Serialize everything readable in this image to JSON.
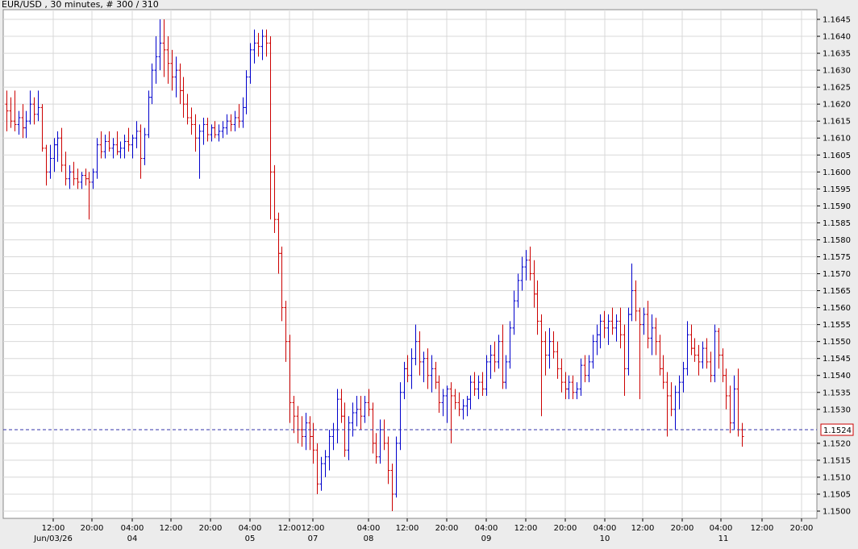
{
  "header": {
    "title": "EUR/USD , 30 minutes, # 300 / 310"
  },
  "colors": {
    "up_bar": "#0000cc",
    "down_bar": "#cc0000",
    "price_line": "#3333aa",
    "price_tag_border": "#cc0000",
    "grid": "#d8d8d8",
    "plot_bg": "#ffffff"
  },
  "chart_data": {
    "type": "ohlc",
    "title": "EUR/USD , 30 minutes, # 300 / 310",
    "grid": true,
    "ylim": [
      1.15,
      1.1645
    ],
    "x_tick_labels": [
      "12:00",
      "20:00",
      "04:00",
      "12:00",
      "20:00",
      "04:00",
      "12:00",
      "12:00",
      "04:00",
      "12:00",
      "20:00",
      "04:00",
      "12:00",
      "20:00",
      "04:00",
      "12:00",
      "20:00",
      "04:00",
      "12:00",
      "20:00"
    ],
    "date_labels": [
      "Jun/03/26",
      "04",
      "05",
      "07",
      "08",
      "09",
      "10",
      "11"
    ],
    "y_tick_labels": [
      "1.1645",
      "1.1640",
      "1.1635",
      "1.1630",
      "1.1625",
      "1.1620",
      "1.1615",
      "1.1610",
      "1.1605",
      "1.1600",
      "1.1595",
      "1.1590",
      "1.1585",
      "1.1580",
      "1.1575",
      "1.1570",
      "1.1565",
      "1.1560",
      "1.1555",
      "1.1550",
      "1.1545",
      "1.1540",
      "1.1535",
      "1.1530",
      "1.1524",
      "1.1520",
      "1.1515",
      "1.1510",
      "1.1505",
      "1.1500"
    ],
    "current_price": "1.1524",
    "bars": [
      [
        1.162,
        1.1624,
        1.1612,
        1.1618
      ],
      [
        1.1618,
        1.1622,
        1.1613,
        1.1615
      ],
      [
        1.1615,
        1.1624,
        1.1612,
        1.1614
      ],
      [
        1.1614,
        1.1618,
        1.1611,
        1.1616
      ],
      [
        1.1616,
        1.162,
        1.161,
        1.1613
      ],
      [
        1.1613,
        1.1618,
        1.161,
        1.1615
      ],
      [
        1.1615,
        1.1624,
        1.1614,
        1.162
      ],
      [
        1.162,
        1.1622,
        1.1614,
        1.1617
      ],
      [
        1.1617,
        1.1624,
        1.1615,
        1.1619
      ],
      [
        1.1619,
        1.162,
        1.1606,
        1.1607
      ],
      [
        1.1607,
        1.1608,
        1.1596,
        1.16
      ],
      [
        1.16,
        1.1608,
        1.1598,
        1.1604
      ],
      [
        1.1604,
        1.161,
        1.16,
        1.1608
      ],
      [
        1.1608,
        1.1612,
        1.1603,
        1.161
      ],
      [
        1.161,
        1.1613,
        1.16,
        1.1602
      ],
      [
        1.1602,
        1.1606,
        1.1596,
        1.1598
      ],
      [
        1.1598,
        1.1602,
        1.1595,
        1.16
      ],
      [
        1.16,
        1.1603,
        1.1596,
        1.1598
      ],
      [
        1.1598,
        1.1601,
        1.1595,
        1.1597
      ],
      [
        1.1597,
        1.16,
        1.1595,
        1.1599
      ],
      [
        1.1599,
        1.1601,
        1.1596,
        1.1598
      ],
      [
        1.1598,
        1.16,
        1.1586,
        1.1597
      ],
      [
        1.1597,
        1.1601,
        1.1595,
        1.16
      ],
      [
        1.16,
        1.161,
        1.1598,
        1.1608
      ],
      [
        1.1608,
        1.1612,
        1.1604,
        1.1606
      ],
      [
        1.1606,
        1.1611,
        1.1604,
        1.1609
      ],
      [
        1.1609,
        1.1612,
        1.1606,
        1.1607
      ],
      [
        1.1607,
        1.161,
        1.1604,
        1.1608
      ],
      [
        1.1608,
        1.1612,
        1.1605,
        1.1606
      ],
      [
        1.1606,
        1.1609,
        1.1604,
        1.1607
      ],
      [
        1.1607,
        1.1611,
        1.1604,
        1.1609
      ],
      [
        1.1609,
        1.1613,
        1.1606,
        1.1608
      ],
      [
        1.1608,
        1.1611,
        1.1604,
        1.161
      ],
      [
        1.161,
        1.1615,
        1.1607,
        1.1612
      ],
      [
        1.1612,
        1.1614,
        1.1598,
        1.1604
      ],
      [
        1.1604,
        1.1613,
        1.1602,
        1.1611
      ],
      [
        1.1611,
        1.1624,
        1.161,
        1.1622
      ],
      [
        1.1622,
        1.1632,
        1.162,
        1.163
      ],
      [
        1.163,
        1.164,
        1.1626,
        1.1634
      ],
      [
        1.1634,
        1.1645,
        1.163,
        1.1638
      ],
      [
        1.1638,
        1.1645,
        1.1628,
        1.1636
      ],
      [
        1.1636,
        1.164,
        1.1626,
        1.1632
      ],
      [
        1.1632,
        1.1636,
        1.1624,
        1.1628
      ],
      [
        1.1628,
        1.1634,
        1.1622,
        1.163
      ],
      [
        1.163,
        1.1632,
        1.162,
        1.1624
      ],
      [
        1.1624,
        1.1628,
        1.1616,
        1.162
      ],
      [
        1.162,
        1.1623,
        1.1614,
        1.1616
      ],
      [
        1.1616,
        1.1619,
        1.1611,
        1.1614
      ],
      [
        1.1614,
        1.1617,
        1.1606,
        1.161
      ],
      [
        1.161,
        1.1614,
        1.1598,
        1.1612
      ],
      [
        1.1612,
        1.1616,
        1.1608,
        1.1614
      ],
      [
        1.1614,
        1.1616,
        1.1609,
        1.1611
      ],
      [
        1.1611,
        1.1614,
        1.1609,
        1.1613
      ],
      [
        1.1613,
        1.1615,
        1.161,
        1.1611
      ],
      [
        1.1611,
        1.1614,
        1.1609,
        1.1612
      ],
      [
        1.1612,
        1.1615,
        1.161,
        1.1613
      ],
      [
        1.1613,
        1.1617,
        1.1611,
        1.1615
      ],
      [
        1.1615,
        1.1617,
        1.1612,
        1.1614
      ],
      [
        1.1614,
        1.1618,
        1.1612,
        1.1616
      ],
      [
        1.1616,
        1.162,
        1.1613,
        1.1615
      ],
      [
        1.1615,
        1.1622,
        1.1613,
        1.1619
      ],
      [
        1.1619,
        1.163,
        1.1617,
        1.1628
      ],
      [
        1.1628,
        1.1638,
        1.1626,
        1.1636
      ],
      [
        1.1636,
        1.1642,
        1.1632,
        1.1638
      ],
      [
        1.1638,
        1.1641,
        1.1634,
        1.1637
      ],
      [
        1.1637,
        1.1642,
        1.1633,
        1.164
      ],
      [
        1.164,
        1.1642,
        1.1634,
        1.1638
      ],
      [
        1.1638,
        1.164,
        1.1586,
        1.16
      ],
      [
        1.16,
        1.1602,
        1.1582,
        1.1586
      ],
      [
        1.1586,
        1.1588,
        1.157,
        1.1576
      ],
      [
        1.1576,
        1.1578,
        1.1556,
        1.156
      ],
      [
        1.156,
        1.1562,
        1.1544,
        1.155
      ],
      [
        1.155,
        1.1552,
        1.1526,
        1.1532
      ],
      [
        1.1532,
        1.1534,
        1.1523,
        1.1528
      ],
      [
        1.1528,
        1.1531,
        1.152,
        1.1524
      ],
      [
        1.1524,
        1.1528,
        1.1519,
        1.1522
      ],
      [
        1.1522,
        1.1529,
        1.1518,
        1.1526
      ],
      [
        1.1526,
        1.1528,
        1.1518,
        1.1522
      ],
      [
        1.1522,
        1.1526,
        1.1514,
        1.1518
      ],
      [
        1.1518,
        1.152,
        1.1505,
        1.1508
      ],
      [
        1.1508,
        1.1516,
        1.1506,
        1.1514
      ],
      [
        1.1514,
        1.1518,
        1.151,
        1.1516
      ],
      [
        1.1516,
        1.1524,
        1.1512,
        1.1522
      ],
      [
        1.1522,
        1.1526,
        1.1518,
        1.1524
      ],
      [
        1.1524,
        1.1536,
        1.152,
        1.1533
      ],
      [
        1.1533,
        1.1536,
        1.1526,
        1.1528
      ],
      [
        1.1528,
        1.1532,
        1.1516,
        1.1518
      ],
      [
        1.1518,
        1.1528,
        1.1515,
        1.1526
      ],
      [
        1.1526,
        1.1532,
        1.1522,
        1.1529
      ],
      [
        1.1529,
        1.1534,
        1.1525,
        1.153
      ],
      [
        1.153,
        1.1534,
        1.1524,
        1.1528
      ],
      [
        1.1528,
        1.1534,
        1.1526,
        1.1532
      ],
      [
        1.1532,
        1.1536,
        1.1528,
        1.153
      ],
      [
        1.153,
        1.1532,
        1.1517,
        1.152
      ],
      [
        1.152,
        1.1523,
        1.1514,
        1.1516
      ],
      [
        1.1516,
        1.1527,
        1.1514,
        1.1524
      ],
      [
        1.1524,
        1.1527,
        1.1518,
        1.152
      ],
      [
        1.152,
        1.1522,
        1.1508,
        1.1512
      ],
      [
        1.1512,
        1.1514,
        1.15,
        1.1505
      ],
      [
        1.1505,
        1.1522,
        1.1504,
        1.152
      ],
      [
        1.152,
        1.1538,
        1.1518,
        1.1535
      ],
      [
        1.1535,
        1.1544,
        1.1533,
        1.1542
      ],
      [
        1.1542,
        1.1546,
        1.1538,
        1.154
      ],
      [
        1.154,
        1.1548,
        1.1536,
        1.1545
      ],
      [
        1.1545,
        1.1555,
        1.1543,
        1.155
      ],
      [
        1.155,
        1.1553,
        1.154,
        1.1544
      ],
      [
        1.1544,
        1.1547,
        1.1538,
        1.1545
      ],
      [
        1.1545,
        1.1548,
        1.1536,
        1.154
      ],
      [
        1.154,
        1.1546,
        1.1535,
        1.1542
      ],
      [
        1.1542,
        1.1544,
        1.1536,
        1.1538
      ],
      [
        1.1538,
        1.154,
        1.1529,
        1.1532
      ],
      [
        1.1532,
        1.1536,
        1.1528,
        1.1534
      ],
      [
        1.1534,
        1.1537,
        1.1526,
        1.1536
      ],
      [
        1.1536,
        1.1538,
        1.152,
        1.1534
      ],
      [
        1.1534,
        1.1536,
        1.153,
        1.1532
      ],
      [
        1.1532,
        1.1535,
        1.1528,
        1.153
      ],
      [
        1.153,
        1.1533,
        1.1527,
        1.1531
      ],
      [
        1.1531,
        1.1534,
        1.1528,
        1.1533
      ],
      [
        1.1533,
        1.154,
        1.153,
        1.1538
      ],
      [
        1.1538,
        1.1541,
        1.1534,
        1.1536
      ],
      [
        1.1536,
        1.154,
        1.1533,
        1.1538
      ],
      [
        1.1538,
        1.1541,
        1.1534,
        1.1536
      ],
      [
        1.1536,
        1.1546,
        1.1534,
        1.1544
      ],
      [
        1.1544,
        1.1549,
        1.1539,
        1.1546
      ],
      [
        1.1546,
        1.155,
        1.1541,
        1.1544
      ],
      [
        1.1544,
        1.1552,
        1.1542,
        1.155
      ],
      [
        1.155,
        1.1555,
        1.1536,
        1.1538
      ],
      [
        1.1538,
        1.1546,
        1.1536,
        1.1544
      ],
      [
        1.1544,
        1.1556,
        1.1542,
        1.1554
      ],
      [
        1.1554,
        1.1565,
        1.1552,
        1.1562
      ],
      [
        1.1562,
        1.157,
        1.156,
        1.1568
      ],
      [
        1.1568,
        1.1575,
        1.1565,
        1.1572
      ],
      [
        1.1572,
        1.1577,
        1.1568,
        1.1574
      ],
      [
        1.1574,
        1.1578,
        1.1568,
        1.157
      ],
      [
        1.157,
        1.1574,
        1.156,
        1.1564
      ],
      [
        1.1564,
        1.1568,
        1.1552,
        1.1556
      ],
      [
        1.1556,
        1.1558,
        1.1528,
        1.155
      ],
      [
        1.155,
        1.1553,
        1.154,
        1.1546
      ],
      [
        1.1546,
        1.1554,
        1.1542,
        1.155
      ],
      [
        1.155,
        1.1553,
        1.1545,
        1.1547
      ],
      [
        1.1547,
        1.155,
        1.1539,
        1.1542
      ],
      [
        1.1542,
        1.1545,
        1.1535,
        1.1538
      ],
      [
        1.1538,
        1.1541,
        1.1533,
        1.1536
      ],
      [
        1.1536,
        1.154,
        1.1533,
        1.1538
      ],
      [
        1.1538,
        1.154,
        1.1533,
        1.1535
      ],
      [
        1.1535,
        1.1538,
        1.1533,
        1.1536
      ],
      [
        1.1536,
        1.1545,
        1.1534,
        1.1543
      ],
      [
        1.1543,
        1.1546,
        1.1538,
        1.154
      ],
      [
        1.154,
        1.1546,
        1.1538,
        1.1544
      ],
      [
        1.1544,
        1.1552,
        1.1542,
        1.155
      ],
      [
        1.155,
        1.1555,
        1.1546,
        1.1552
      ],
      [
        1.1552,
        1.1558,
        1.1548,
        1.1556
      ],
      [
        1.1556,
        1.1559,
        1.1551,
        1.1554
      ],
      [
        1.1554,
        1.1558,
        1.1549,
        1.1556
      ],
      [
        1.1556,
        1.156,
        1.1552,
        1.1554
      ],
      [
        1.1554,
        1.1558,
        1.155,
        1.1556
      ],
      [
        1.1556,
        1.156,
        1.1548,
        1.1552
      ],
      [
        1.1552,
        1.1555,
        1.1534,
        1.1542
      ],
      [
        1.1542,
        1.156,
        1.154,
        1.1558
      ],
      [
        1.1558,
        1.1573,
        1.1556,
        1.1565
      ],
      [
        1.1565,
        1.1568,
        1.1556,
        1.1559
      ],
      [
        1.1559,
        1.156,
        1.1533,
        1.1555
      ],
      [
        1.1555,
        1.156,
        1.1552,
        1.1558
      ],
      [
        1.1558,
        1.1562,
        1.1548,
        1.1551
      ],
      [
        1.1551,
        1.1558,
        1.1546,
        1.1554
      ],
      [
        1.1554,
        1.1557,
        1.1546,
        1.155
      ],
      [
        1.155,
        1.1552,
        1.154,
        1.1542
      ],
      [
        1.1542,
        1.1546,
        1.1536,
        1.1538
      ],
      [
        1.1538,
        1.1541,
        1.1522,
        1.1534
      ],
      [
        1.1534,
        1.1538,
        1.1528,
        1.153
      ],
      [
        1.153,
        1.1537,
        1.1524,
        1.1535
      ],
      [
        1.1535,
        1.154,
        1.153,
        1.1538
      ],
      [
        1.1538,
        1.1544,
        1.1535,
        1.1542
      ],
      [
        1.1542,
        1.1556,
        1.154,
        1.1552
      ],
      [
        1.1552,
        1.1555,
        1.1546,
        1.1548
      ],
      [
        1.1548,
        1.1551,
        1.1544,
        1.1546
      ],
      [
        1.1546,
        1.1549,
        1.154,
        1.1544
      ],
      [
        1.1544,
        1.155,
        1.1542,
        1.1548
      ],
      [
        1.1548,
        1.1551,
        1.1542,
        1.1544
      ],
      [
        1.1544,
        1.1547,
        1.1538,
        1.154
      ],
      [
        1.154,
        1.1555,
        1.1538,
        1.1553
      ],
      [
        1.1553,
        1.1554,
        1.1542,
        1.1546
      ],
      [
        1.1546,
        1.1548,
        1.1538,
        1.154
      ],
      [
        1.154,
        1.1542,
        1.153,
        1.1534
      ],
      [
        1.1534,
        1.1537,
        1.1523,
        1.1526
      ],
      [
        1.1526,
        1.154,
        1.1524,
        1.1536
      ],
      [
        1.1536,
        1.1542,
        1.1522,
        1.1524
      ],
      [
        1.1524,
        1.1526,
        1.1519,
        1.1522
      ]
    ]
  }
}
